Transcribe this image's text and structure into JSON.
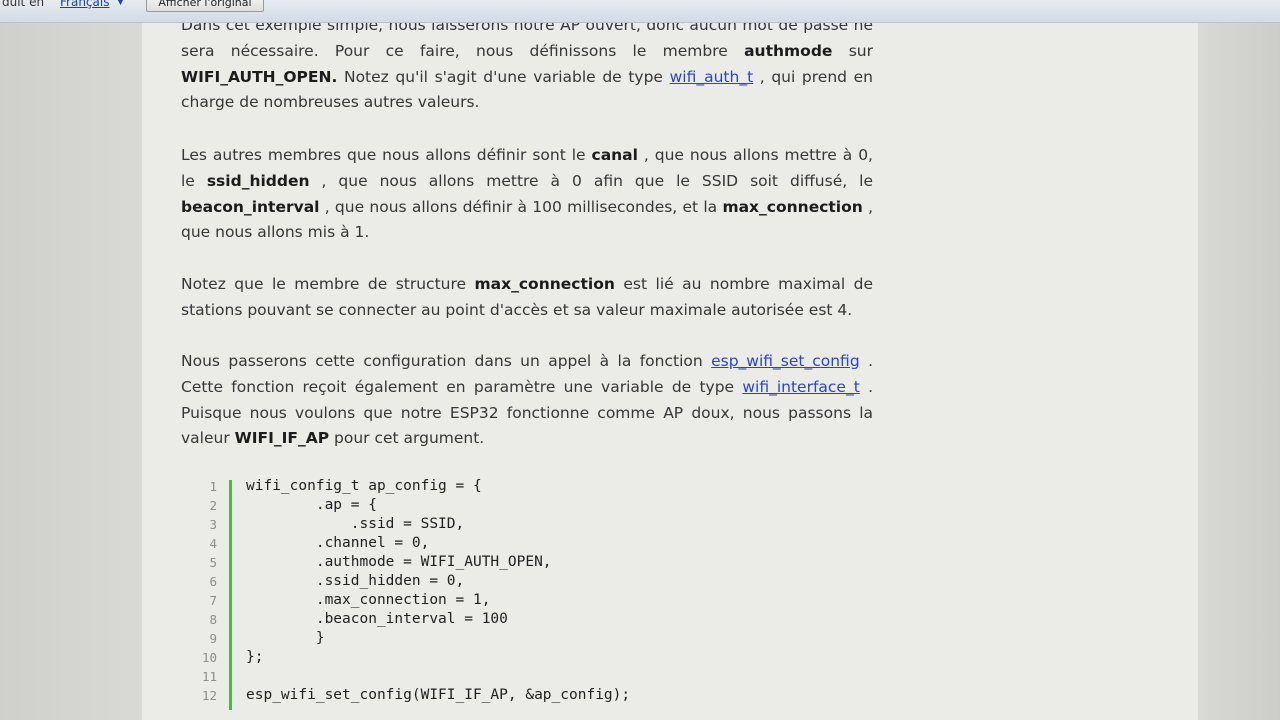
{
  "translate_bar": {
    "prefix_text": "duit en",
    "language": "Français",
    "show_original_button": "Afficher l'original"
  },
  "article": {
    "p1": {
      "t1": "Dans cet exemple simple, nous laisserons notre AP ouvert, donc aucun mot de passe ne sera nécessaire. Pour ce faire, nous définissons le membre ",
      "b1": "authmode",
      "t2": " sur ",
      "b2": "WIFI_AUTH_OPEN.",
      "t3": " Notez qu'il s'agit d'une variable de type ",
      "link1": "wifi_auth_t",
      "t4": " , qui prend en charge de nombreuses autres valeurs."
    },
    "p2": {
      "t1": "Les autres membres que nous allons définir sont le ",
      "b1": "canal",
      "t2": " , que nous allons mettre à 0, le ",
      "b2": "ssid_hidden",
      "t3": " , que nous allons mettre à 0 afin que le SSID soit diffusé, le ",
      "b3": "beacon_interval",
      "t4": " , que nous allons définir à 100 millisecondes, et la ",
      "b4": "max_connection",
      "t5": " , que nous allons mis à 1."
    },
    "p3": {
      "t1": "Notez que le membre de structure ",
      "b1": "max_connection",
      "t2": " est lié au nombre maximal de stations pouvant se connecter au point d'accès et sa valeur maximale autorisée est 4."
    },
    "p4": {
      "t1": "Nous passerons cette configuration dans un appel à la  fonction ",
      "link1": "esp_wifi_set_config",
      "t2": " . Cette fonction reçoit également en paramètre une variable de type ",
      "link2": "wifi_interface_t",
      "t3": " . Puisque nous voulons que notre ESP32 fonctionne comme AP doux, nous passons la valeur ",
      "b1": "WIFI_IF_AP",
      "t4": " pour cet argument."
    }
  },
  "code": {
    "lines": [
      {
        "n": "1",
        "text": "wifi_config_t ap_config = {"
      },
      {
        "n": "2",
        "text": "        .ap = {"
      },
      {
        "n": "3",
        "text": "            .ssid = SSID,"
      },
      {
        "n": "4",
        "text": "        .channel = 0,"
      },
      {
        "n": "5",
        "text": "        .authmode = WIFI_AUTH_OPEN,"
      },
      {
        "n": "6",
        "text": "        .ssid_hidden = 0,"
      },
      {
        "n": "7",
        "text": "        .max_connection = 1,"
      },
      {
        "n": "8",
        "text": "        .beacon_interval = 100"
      },
      {
        "n": "9",
        "text": "        }"
      },
      {
        "n": "10",
        "text": "};"
      },
      {
        "n": "11",
        "text": ""
      },
      {
        "n": "12",
        "text": "esp_wifi_set_config(WIFI_IF_AP, &ap_config);"
      }
    ]
  },
  "colors": {
    "link": "#2a45c6",
    "code_gutter_accent": "#4cb648"
  }
}
